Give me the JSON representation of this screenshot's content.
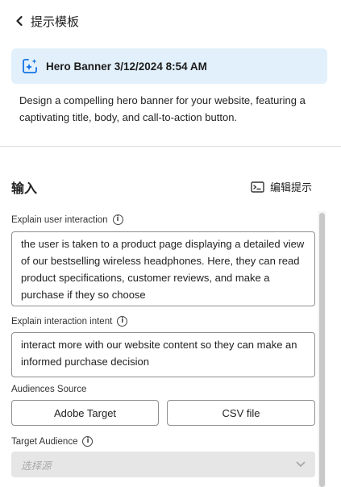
{
  "header": {
    "back_icon": "chevron-left-icon",
    "title": "提示模板"
  },
  "banner": {
    "icon": "sparkle-frame-icon",
    "title": "Hero Banner 3/12/2024 8:54 AM",
    "background": "#e2f0fb"
  },
  "description": "Design a compelling hero banner for your website, featuring a captivating title, body, and call-to-action button.",
  "input_section": {
    "title": "输入",
    "edit_prompt": {
      "icon": "terminal-icon",
      "label": "编辑提示"
    }
  },
  "fields": {
    "user_interaction": {
      "label": "Explain user interaction",
      "value": "the user is taken to a product page displaying a detailed view of our bestselling wireless headphones. Here, they can read product specifications, customer reviews, and make a purchase if they so choose"
    },
    "interaction_intent": {
      "label": "Explain interaction intent",
      "value": "interact more with our website content so they can make an informed purchase decision"
    },
    "audiences_source": {
      "label": "Audiences Source",
      "options": [
        "Adobe Target",
        "CSV file"
      ]
    },
    "target_audience": {
      "label": "Target Audience",
      "placeholder": "选择源",
      "chevron_icon": "chevron-down-icon"
    }
  }
}
